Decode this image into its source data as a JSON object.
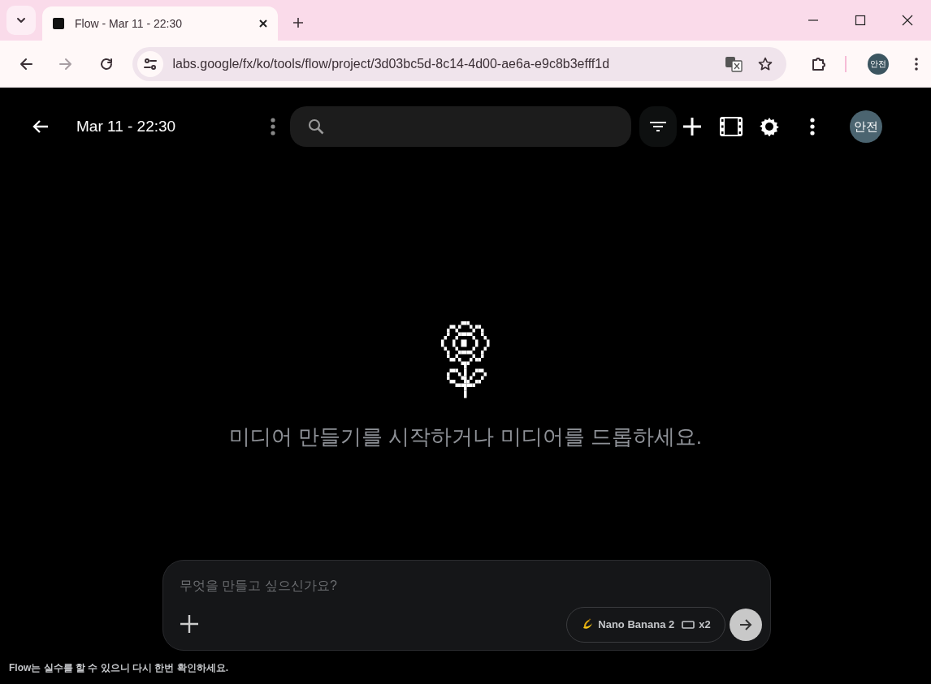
{
  "browser": {
    "tab_title": "Flow - Mar 11 - 22:30",
    "url": "labs.google/fx/ko/tools/flow/project/3d03bc5d-8c14-4d00-ae6a-e9c8b3efff1d",
    "profile": "안전"
  },
  "app": {
    "title": "Mar 11 - 22:30",
    "avatar": "안전"
  },
  "empty_state": {
    "message": "미디어 만들기를 시작하거나 미디어를 드롭하세요."
  },
  "prompt": {
    "placeholder": "무엇을 만들고 싶으신가요?",
    "model": "Nano Banana 2",
    "count": "x2"
  },
  "disclaimer": "Flow는 실수를 할 수 있으니 다시 한번 확인하세요."
}
